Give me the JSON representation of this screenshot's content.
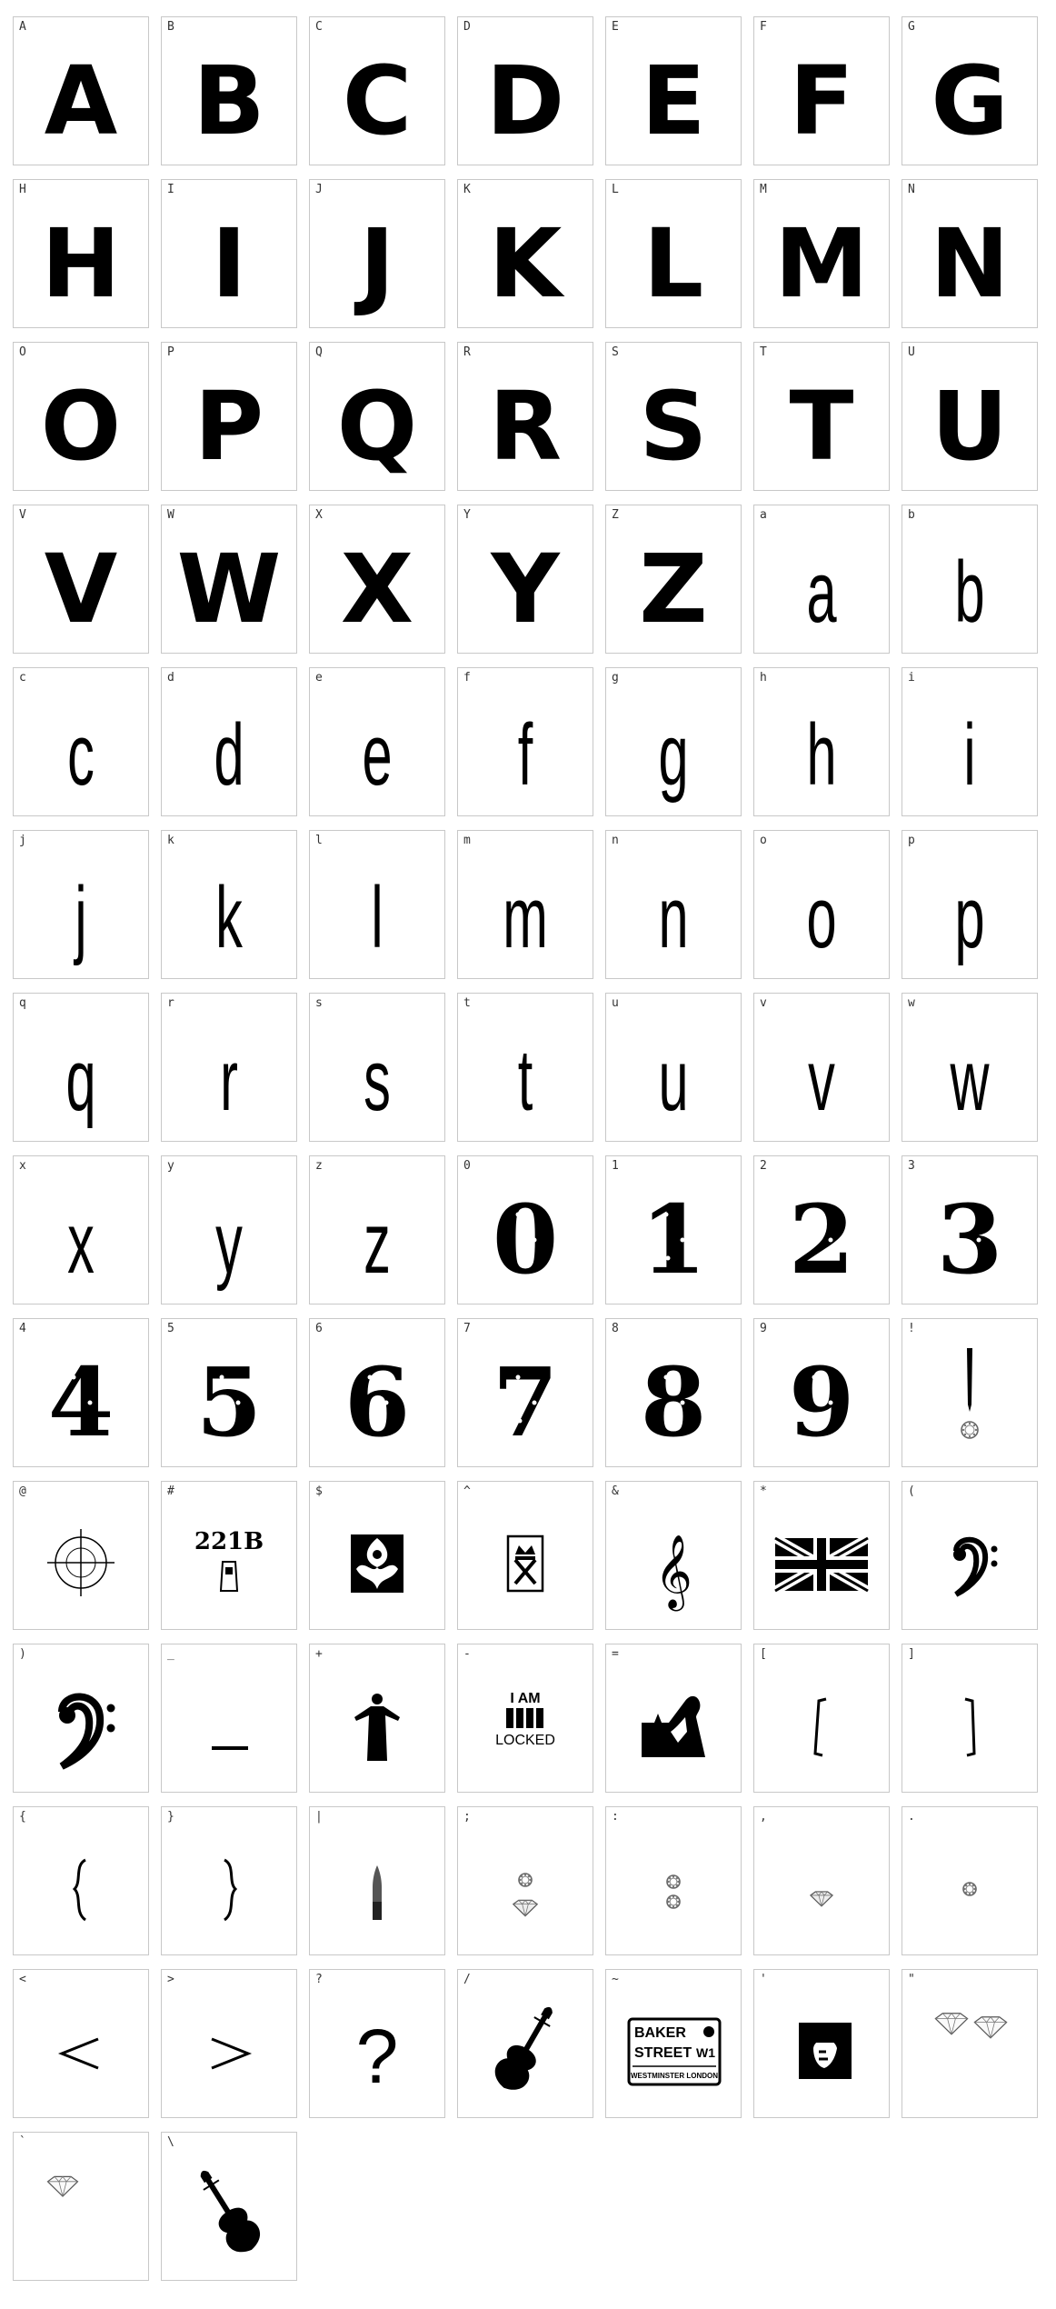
{
  "glyphs": [
    {
      "char": "A",
      "kind": "upper"
    },
    {
      "char": "B",
      "kind": "upper"
    },
    {
      "char": "C",
      "kind": "upper"
    },
    {
      "char": "D",
      "kind": "upper"
    },
    {
      "char": "E",
      "kind": "upper"
    },
    {
      "char": "F",
      "kind": "upper"
    },
    {
      "char": "G",
      "kind": "upper"
    },
    {
      "char": "H",
      "kind": "upper"
    },
    {
      "char": "I",
      "kind": "upper"
    },
    {
      "char": "J",
      "kind": "upper"
    },
    {
      "char": "K",
      "kind": "upper"
    },
    {
      "char": "L",
      "kind": "upper"
    },
    {
      "char": "M",
      "kind": "upper"
    },
    {
      "char": "N",
      "kind": "upper"
    },
    {
      "char": "O",
      "kind": "upper"
    },
    {
      "char": "P",
      "kind": "upper"
    },
    {
      "char": "Q",
      "kind": "upper"
    },
    {
      "char": "R",
      "kind": "upper"
    },
    {
      "char": "S",
      "kind": "upper"
    },
    {
      "char": "T",
      "kind": "upper"
    },
    {
      "char": "U",
      "kind": "upper"
    },
    {
      "char": "V",
      "kind": "upper"
    },
    {
      "char": "W",
      "kind": "upper"
    },
    {
      "char": "X",
      "kind": "upper"
    },
    {
      "char": "Y",
      "kind": "upper"
    },
    {
      "char": "Z",
      "kind": "upper"
    },
    {
      "char": "a",
      "kind": "lower"
    },
    {
      "char": "b",
      "kind": "lower"
    },
    {
      "char": "c",
      "kind": "lower"
    },
    {
      "char": "d",
      "kind": "lower"
    },
    {
      "char": "e",
      "kind": "lower"
    },
    {
      "char": "f",
      "kind": "lower"
    },
    {
      "char": "g",
      "kind": "lower"
    },
    {
      "char": "h",
      "kind": "lower"
    },
    {
      "char": "i",
      "kind": "lower"
    },
    {
      "char": "j",
      "kind": "lower"
    },
    {
      "char": "k",
      "kind": "lower"
    },
    {
      "char": "l",
      "kind": "lower"
    },
    {
      "char": "m",
      "kind": "lower"
    },
    {
      "char": "n",
      "kind": "lower"
    },
    {
      "char": "o",
      "kind": "lower"
    },
    {
      "char": "p",
      "kind": "lower"
    },
    {
      "char": "q",
      "kind": "lower"
    },
    {
      "char": "r",
      "kind": "lower"
    },
    {
      "char": "s",
      "kind": "lower"
    },
    {
      "char": "t",
      "kind": "lower"
    },
    {
      "char": "u",
      "kind": "lower"
    },
    {
      "char": "v",
      "kind": "lower"
    },
    {
      "char": "w",
      "kind": "lower"
    },
    {
      "char": "x",
      "kind": "lower"
    },
    {
      "char": "y",
      "kind": "lower"
    },
    {
      "char": "z",
      "kind": "lower"
    },
    {
      "char": "0",
      "kind": "digit"
    },
    {
      "char": "1",
      "kind": "digit"
    },
    {
      "char": "2",
      "kind": "digit"
    },
    {
      "char": "3",
      "kind": "digit"
    },
    {
      "char": "4",
      "kind": "digit"
    },
    {
      "char": "5",
      "kind": "digit"
    },
    {
      "char": "6",
      "kind": "digit"
    },
    {
      "char": "7",
      "kind": "digit"
    },
    {
      "char": "8",
      "kind": "digit"
    },
    {
      "char": "9",
      "kind": "digit"
    },
    {
      "char": "!",
      "kind": "icon",
      "icon": "bullet-ring-icon"
    },
    {
      "char": "@",
      "kind": "icon",
      "icon": "crosshair-icon"
    },
    {
      "char": "#",
      "kind": "icon",
      "icon": "221b-door-sign-icon",
      "text": "221B"
    },
    {
      "char": "$",
      "kind": "icon",
      "icon": "wallpaper-ornament-icon"
    },
    {
      "char": "^",
      "kind": "icon",
      "icon": "royal-cypher-icon"
    },
    {
      "char": "&",
      "kind": "icon",
      "icon": "treble-clef-icon"
    },
    {
      "char": "*",
      "kind": "icon",
      "icon": "union-jack-icon"
    },
    {
      "char": "(",
      "kind": "icon",
      "icon": "bass-clef-small-icon"
    },
    {
      "char": ")",
      "kind": "icon",
      "icon": "bass-clef-icon"
    },
    {
      "char": "_",
      "kind": "icon",
      "icon": "underscore-bar-icon"
    },
    {
      "char": "+",
      "kind": "icon",
      "icon": "coat-figure-icon"
    },
    {
      "char": "-",
      "kind": "icon",
      "icon": "i-am-locked-icon",
      "text_top": "I AM",
      "text_bottom": "LOCKED"
    },
    {
      "char": "=",
      "kind": "icon",
      "icon": "silhouette-skyline-icon"
    },
    {
      "char": "[",
      "kind": "icon",
      "icon": "left-bracket-icon"
    },
    {
      "char": "]",
      "kind": "icon",
      "icon": "right-bracket-icon"
    },
    {
      "char": "{",
      "kind": "icon",
      "icon": "left-brace-icon"
    },
    {
      "char": "}",
      "kind": "icon",
      "icon": "right-brace-icon"
    },
    {
      "char": "|",
      "kind": "icon",
      "icon": "bullet-icon"
    },
    {
      "char": ";",
      "kind": "icon",
      "icon": "ring-diamond-icon"
    },
    {
      "char": ":",
      "kind": "icon",
      "icon": "two-rings-icon"
    },
    {
      "char": ",",
      "kind": "icon",
      "icon": "diamond-small-icon"
    },
    {
      "char": ".",
      "kind": "icon",
      "icon": "ring-small-icon"
    },
    {
      "char": "<",
      "kind": "icon",
      "icon": "less-than-icon"
    },
    {
      "char": ">",
      "kind": "icon",
      "icon": "greater-than-icon"
    },
    {
      "char": "?",
      "kind": "icon",
      "icon": "question-mark-icon"
    },
    {
      "char": "/",
      "kind": "icon",
      "icon": "violin-icon"
    },
    {
      "char": "~",
      "kind": "icon",
      "icon": "baker-street-sign-icon",
      "line1": "BAKER",
      "line2": "STREET",
      "badge": "W1",
      "footer": "WESTMINSTER LONDON"
    },
    {
      "char": "'",
      "kind": "icon",
      "icon": "hat-portrait-icon"
    },
    {
      "char": "\"",
      "kind": "icon",
      "icon": "two-diamonds-icon"
    },
    {
      "char": "`",
      "kind": "icon",
      "icon": "diamond-outline-icon"
    },
    {
      "char": "\\",
      "kind": "icon",
      "icon": "violin-tilted-icon"
    }
  ]
}
